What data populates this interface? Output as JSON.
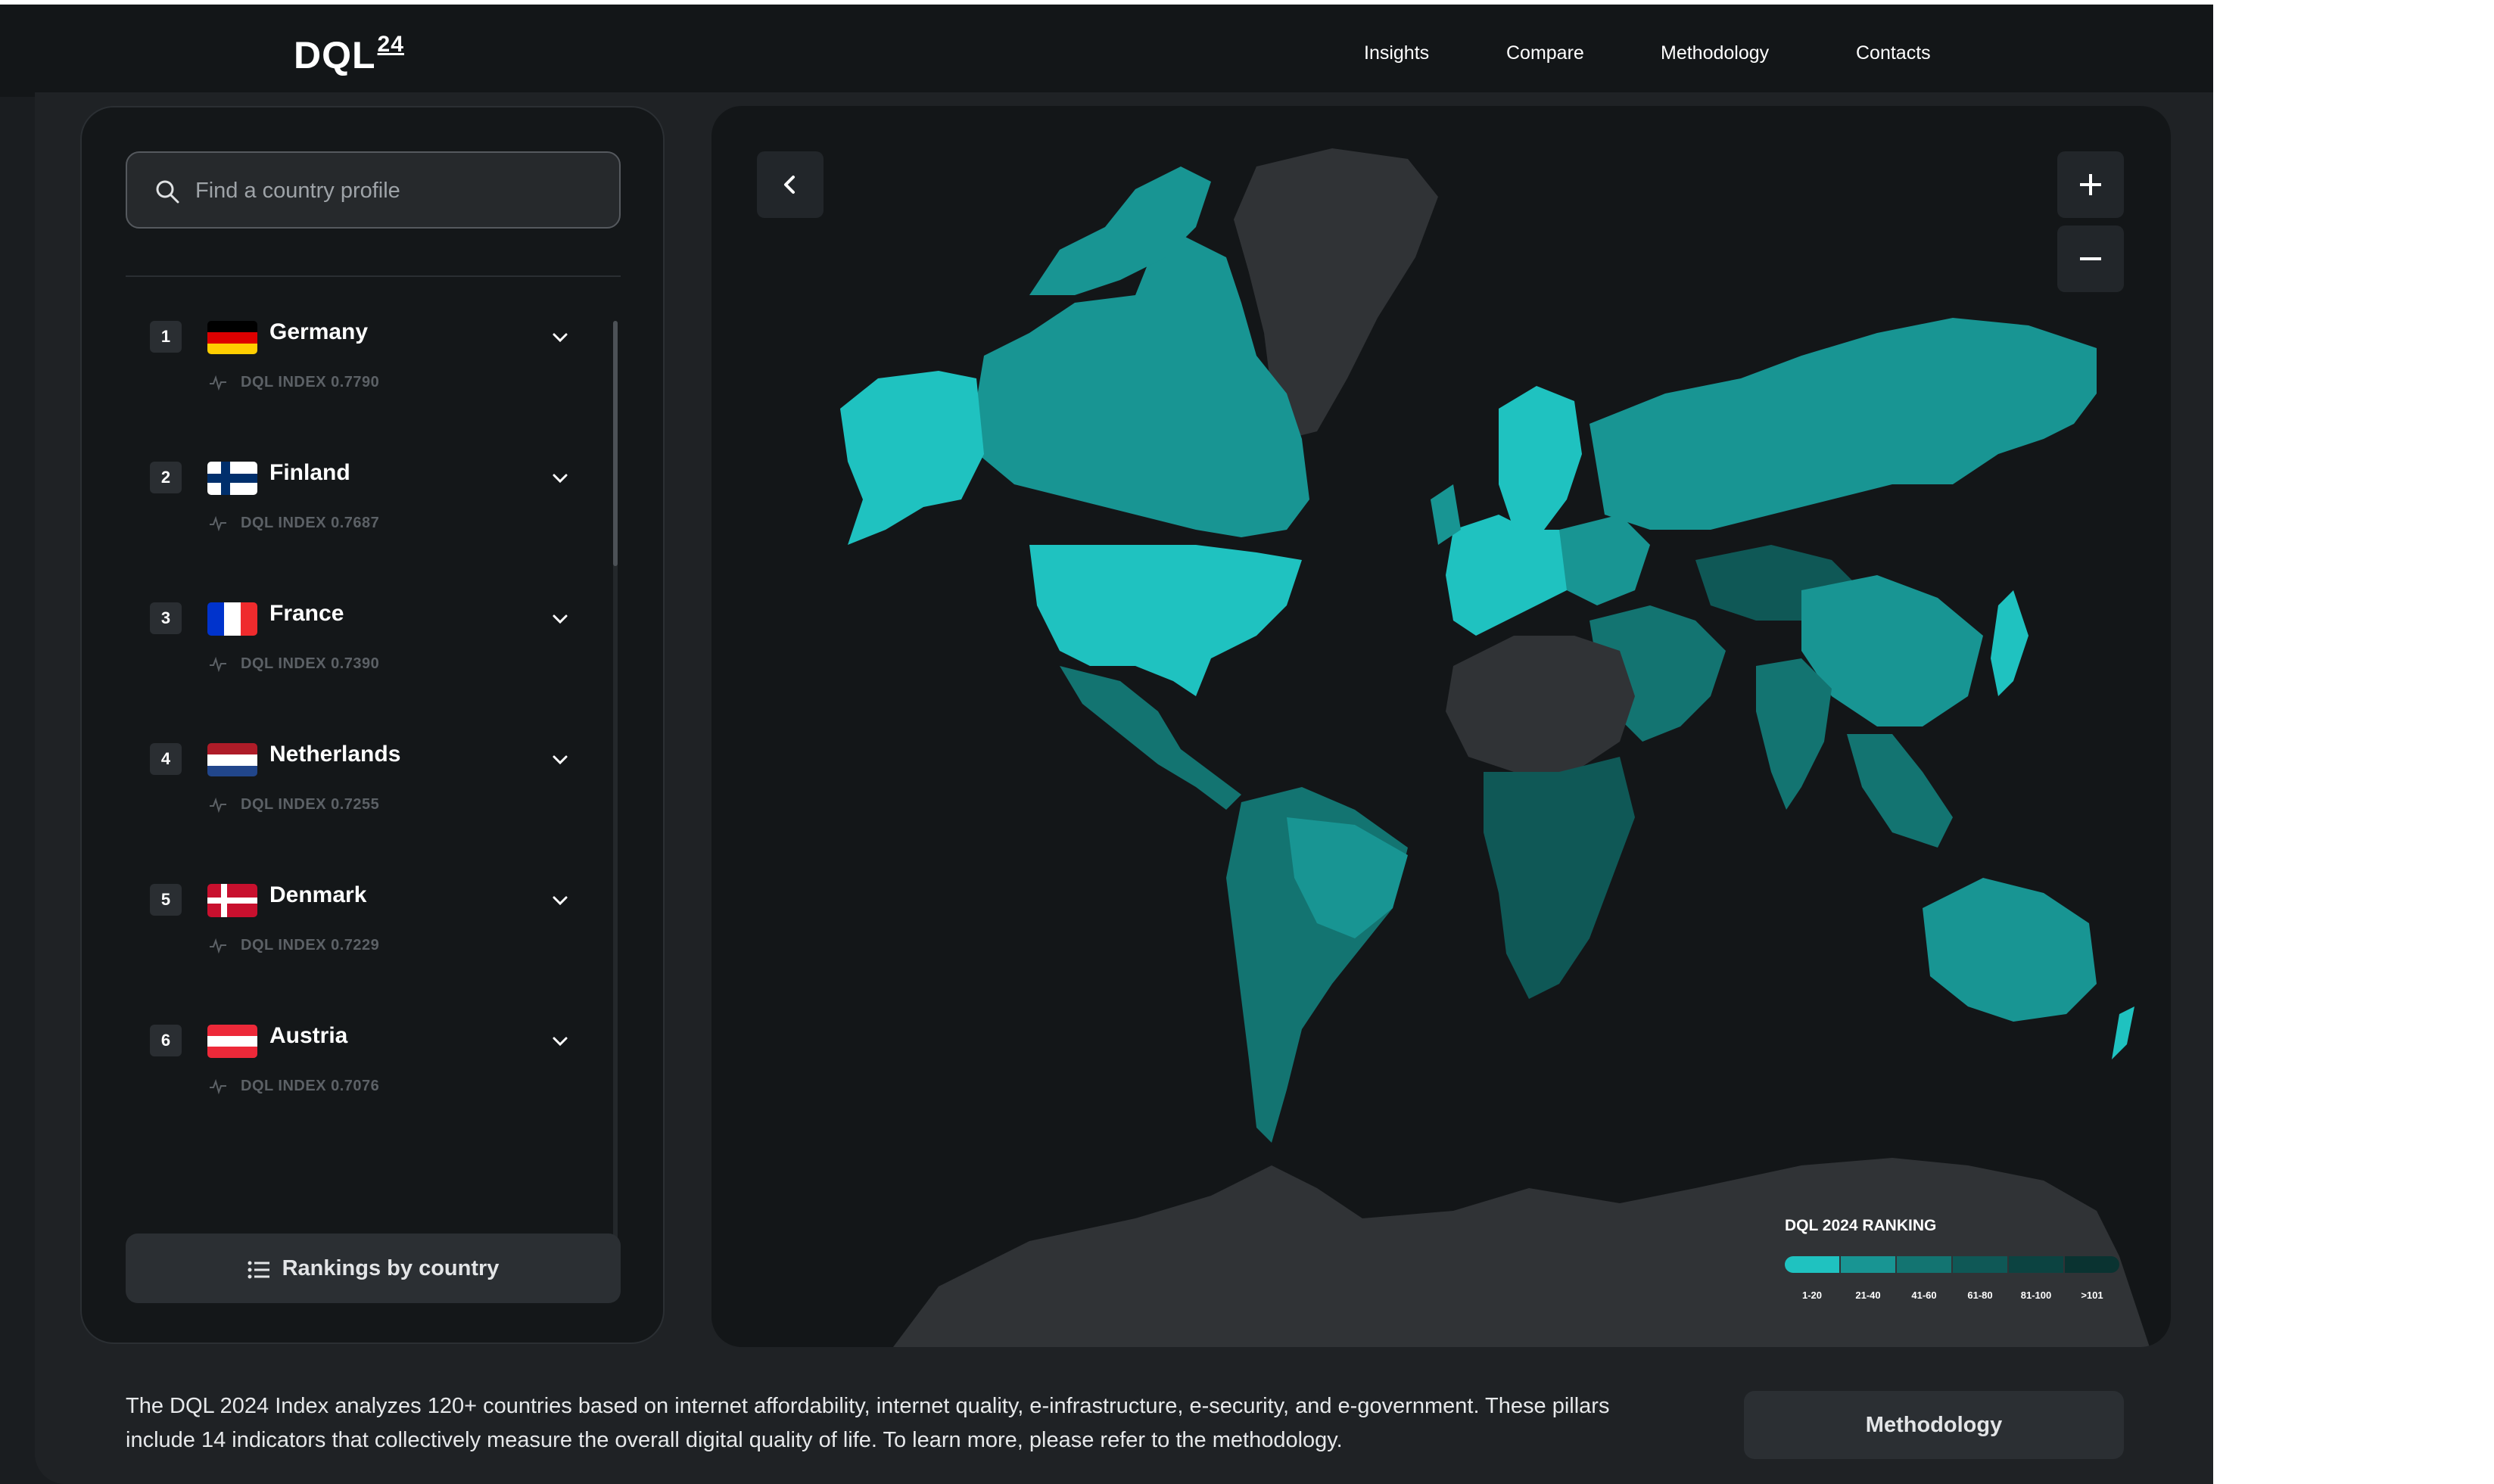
{
  "header": {
    "logo_text": "DQL",
    "logo_sup": "24",
    "nav": [
      "Insights",
      "Compare",
      "Methodology",
      "Contacts"
    ]
  },
  "sidebar": {
    "search_placeholder": "Find a country profile",
    "countries": [
      {
        "rank": "1",
        "name": "Germany",
        "index": "DQL INDEX 0.7790"
      },
      {
        "rank": "2",
        "name": "Finland",
        "index": "DQL INDEX 0.7687"
      },
      {
        "rank": "3",
        "name": "France",
        "index": "DQL INDEX 0.7390"
      },
      {
        "rank": "4",
        "name": "Netherlands",
        "index": "DQL INDEX 0.7255"
      },
      {
        "rank": "5",
        "name": "Denmark",
        "index": "DQL INDEX 0.7229"
      },
      {
        "rank": "6",
        "name": "Austria",
        "index": "DQL INDEX 0.7076"
      }
    ],
    "rankings_button": "Rankings by country"
  },
  "map": {
    "legend_title": "DQL 2024 RANKING",
    "legend": [
      {
        "label": "1-20",
        "color": "#1fc2c0"
      },
      {
        "label": "21-40",
        "color": "#189593"
      },
      {
        "label": "41-60",
        "color": "#137471"
      },
      {
        "label": "61-80",
        "color": "#0f5856"
      },
      {
        "label": "81-100",
        "color": "#0c4341"
      },
      {
        "label": ">101",
        "color": "#0a3331"
      }
    ],
    "no_data_color": "#303336"
  },
  "footer": {
    "description_line1": "The DQL 2024 Index analyzes 120+ countries based on internet affordability, internet quality, e-infrastructure, e-security, and e-government. These pillars",
    "description_line2": "include 14 indicators that collectively measure the overall digital quality of life. To learn more, please refer to the methodology.",
    "methodology_button": "Methodology"
  }
}
